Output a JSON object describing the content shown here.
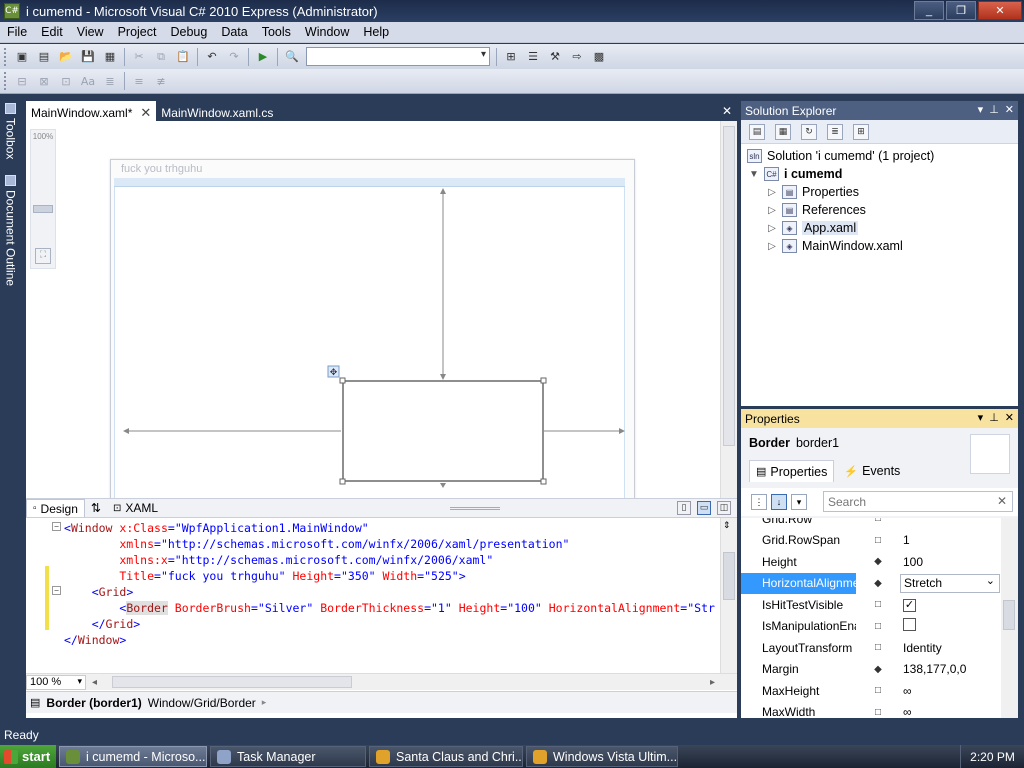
{
  "window": {
    "title": "i cumemd - Microsoft Visual C# 2010 Express (Administrator)",
    "controls": {
      "minimize": "_",
      "maximize": "❐",
      "close": "✕"
    }
  },
  "menu": [
    "File",
    "Edit",
    "View",
    "Project",
    "Debug",
    "Data",
    "Tools",
    "Window",
    "Help"
  ],
  "sidebar": {
    "toolbox": "Toolbox",
    "outline": "Document Outline"
  },
  "editor": {
    "tabs": [
      {
        "label": "MainWindow.xaml*",
        "close": "✕"
      },
      {
        "label": "MainWindow.xaml.cs"
      }
    ],
    "tab_close_all": "✕",
    "designer": {
      "zoom_label": "100%",
      "window_title": "fuck you trhguhu"
    },
    "views": {
      "design": "Design",
      "swap": "⇅",
      "xaml": "XAML"
    },
    "xaml_lines": [
      {
        "parts": [
          [
            "br",
            "<"
          ],
          [
            "el",
            "Window"
          ],
          [
            "at",
            " x:Class"
          ],
          [
            "br",
            "="
          ],
          [
            "va",
            "\"WpfApplication1.MainWindow\""
          ]
        ]
      },
      {
        "parts": [
          [
            "at",
            "        xmlns"
          ],
          [
            "br",
            "="
          ],
          [
            "va",
            "\"http://schemas.microsoft.com/winfx/2006/xaml/presentation\""
          ]
        ]
      },
      {
        "parts": [
          [
            "at",
            "        xmlns:x"
          ],
          [
            "br",
            "="
          ],
          [
            "va",
            "\"http://schemas.microsoft.com/winfx/2006/xaml\""
          ]
        ]
      },
      {
        "parts": [
          [
            "at",
            "        Title"
          ],
          [
            "br",
            "="
          ],
          [
            "va",
            "\"fuck you trhguhu\""
          ],
          [
            "at",
            " Height"
          ],
          [
            "br",
            "="
          ],
          [
            "va",
            "\"350\""
          ],
          [
            "at",
            " Width"
          ],
          [
            "br",
            "="
          ],
          [
            "va",
            "\"525\""
          ],
          [
            "br",
            ">"
          ]
        ]
      },
      {
        "parts": [
          [
            "br",
            "    <"
          ],
          [
            "el",
            "Grid"
          ],
          [
            "br",
            ">"
          ]
        ]
      },
      {
        "parts": [
          [
            "br",
            "        <"
          ],
          [
            "el",
            "Border"
          ],
          [
            "at",
            " BorderBrush"
          ],
          [
            "br",
            "="
          ],
          [
            "va",
            "\"Silver\""
          ],
          [
            "at",
            " BorderThickness"
          ],
          [
            "br",
            "="
          ],
          [
            "va",
            "\"1\""
          ],
          [
            "at",
            " Height"
          ],
          [
            "br",
            "="
          ],
          [
            "va",
            "\"100\""
          ],
          [
            "at",
            " HorizontalAlignment"
          ],
          [
            "br",
            "="
          ],
          [
            "va",
            "\"Str"
          ]
        ]
      },
      {
        "parts": [
          [
            "br",
            "    </"
          ],
          [
            "el",
            "Grid"
          ],
          [
            "br",
            ">"
          ]
        ]
      },
      {
        "parts": [
          [
            "br",
            "</"
          ],
          [
            "el",
            "Window"
          ],
          [
            "br",
            ">"
          ]
        ]
      }
    ],
    "zoom": "100 %",
    "breadcrumb": {
      "element": "Border (border1)",
      "path": "Window/Grid/Border"
    }
  },
  "solution_explorer": {
    "title": "Solution Explorer",
    "items": [
      {
        "label": "Solution 'i cumemd' (1 project)",
        "arrow": "",
        "icon": "sln"
      },
      {
        "label": "i cumemd",
        "arrow": "▼",
        "icon": "C#",
        "bold": true
      },
      {
        "label": "Properties",
        "arrow": "▷",
        "icon": "▤"
      },
      {
        "label": "References",
        "arrow": "▷",
        "icon": "▤"
      },
      {
        "label": "App.xaml",
        "arrow": "▷",
        "icon": "◈"
      },
      {
        "label": "MainWindow.xaml",
        "arrow": "▷",
        "icon": "◈"
      }
    ]
  },
  "properties": {
    "title": "Properties",
    "type": "Border",
    "name": "border1",
    "tab_properties": "Properties",
    "tab_events": "Events",
    "search_placeholder": "Search",
    "rows": [
      {
        "name": "Grid.Row",
        "mark": "□",
        "value": ""
      },
      {
        "name": "Grid.RowSpan",
        "mark": "□",
        "value": "1"
      },
      {
        "name": "Height",
        "mark": "◆",
        "value": "100"
      },
      {
        "name": "HorizontalAlignme...",
        "mark": "◆",
        "value": "Stretch",
        "selected": true
      },
      {
        "name": "IsHitTestVisible",
        "mark": "□",
        "value": "",
        "check": "✓"
      },
      {
        "name": "IsManipulationEna...",
        "mark": "□",
        "value": "",
        "check": " "
      },
      {
        "name": "LayoutTransform",
        "mark": "□",
        "value": "Identity"
      },
      {
        "name": "Margin",
        "mark": "◆",
        "value": "138,177,0,0"
      },
      {
        "name": "MaxHeight",
        "mark": "□",
        "value": "∞"
      },
      {
        "name": "MaxWidth",
        "mark": "□",
        "value": "∞"
      }
    ]
  },
  "status": "Ready",
  "taskbar": {
    "start": "start",
    "tasks": [
      {
        "label": "i cumemd - Microso...",
        "color": "#6a8f3a",
        "active": true
      },
      {
        "label": "Task Manager",
        "color": "#8fa3c8"
      },
      {
        "label": "Santa Claus and Chri...",
        "color": "#e0a22a"
      },
      {
        "label": "Windows Vista Ultim...",
        "color": "#e0a22a"
      }
    ],
    "clock": "2:20 PM"
  }
}
